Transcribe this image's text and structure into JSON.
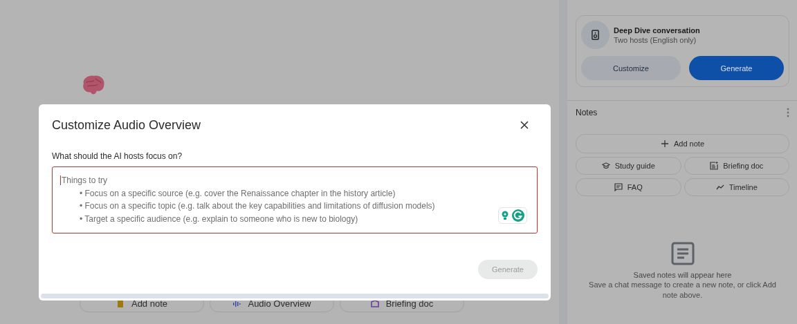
{
  "background_chips": [
    {
      "label": "Add note",
      "kind": "note"
    },
    {
      "label": "Audio Overview",
      "kind": "audio"
    },
    {
      "label": "Briefing doc",
      "kind": "briefing"
    }
  ],
  "audio_card": {
    "title": "Deep Dive conversation",
    "subtitle": "Two hosts (English only)",
    "buttons": [
      {
        "label": "Customize",
        "kind": "secondary"
      },
      {
        "label": "Generate",
        "kind": "primary"
      }
    ]
  },
  "notes": {
    "title": "Notes",
    "add_button": "Add note",
    "actions": [
      {
        "label": "Study guide",
        "kind": "study"
      },
      {
        "label": "Briefing doc",
        "kind": "briefing"
      },
      {
        "label": "FAQ",
        "kind": "faq"
      },
      {
        "label": "Timeline",
        "kind": "timeline"
      }
    ],
    "empty_title": "Saved notes will appear here",
    "empty_text": "Save a chat message to create a new note, or click Add note above."
  },
  "dialog": {
    "title": "Customize Audio Overview",
    "question": "What should the AI hosts focus on?",
    "placeholder": {
      "heading": "Things to try",
      "items": [
        "• Focus on a specific source (e.g. cover the Renaissance chapter in the history article)",
        "• Focus on a specific topic (e.g. talk about the key capabilities and limitations of diffusion models)",
        "• Target a specific audience (e.g. explain to someone who is new to biology)"
      ]
    },
    "generate_button": {
      "label": "Generate",
      "disabled": true
    }
  }
}
